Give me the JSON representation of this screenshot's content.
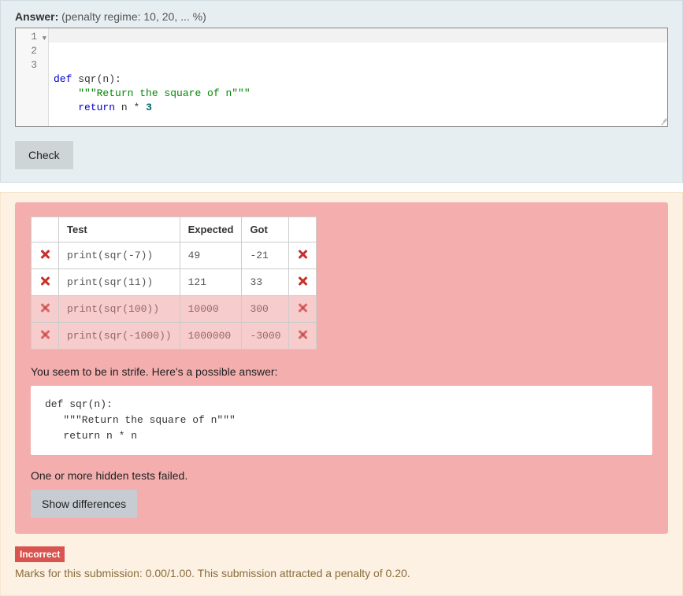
{
  "answer": {
    "label": "Answer:",
    "penalty": "(penalty regime: 10, 20, ... %)",
    "code_kw1": "def",
    "code_fn": " sqr(n):",
    "code_docstring": "\"\"\"Return the square of n\"\"\"",
    "code_kw2": "return",
    "code_expr_a": " n ",
    "code_op": "*",
    "code_expr_b": " ",
    "code_num": "3",
    "check_btn": "Check"
  },
  "results": {
    "headers": {
      "test": "Test",
      "expected": "Expected",
      "got": "Got"
    },
    "rows": [
      {
        "test": "print(sqr(-7))",
        "expected": "49",
        "got": "-21",
        "dim": false
      },
      {
        "test": "print(sqr(11))",
        "expected": "121",
        "got": "33",
        "dim": false
      },
      {
        "test": "print(sqr(100))",
        "expected": "10000",
        "got": "300",
        "dim": true
      },
      {
        "test": "print(sqr(-1000))",
        "expected": "1000000",
        "got": "-3000",
        "dim": true
      }
    ],
    "strife": "You seem to be in strife. Here's a possible answer:",
    "solution": "def sqr(n):\n   \"\"\"Return the square of n\"\"\"\n   return n * n",
    "hidden_fail": "One or more hidden tests failed.",
    "show_diff": "Show differences"
  },
  "grade": {
    "badge": "Incorrect",
    "marks": "Marks for this submission: 0.00/1.00. This submission attracted a penalty of 0.20."
  }
}
